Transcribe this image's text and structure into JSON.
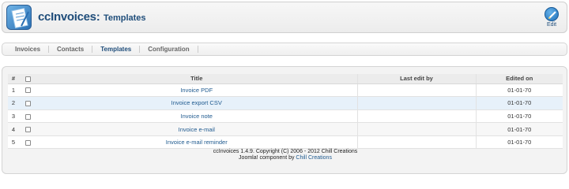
{
  "header": {
    "logo_icon": "invoice-logo-icon",
    "app_name": "ccInvoices:",
    "page_name": "Templates",
    "edit_label": "Edit",
    "edit_icon": "pencil-icon"
  },
  "tabs": [
    {
      "label": "Invoices",
      "active": false
    },
    {
      "label": "Contacts",
      "active": false
    },
    {
      "label": "Templates",
      "active": true
    },
    {
      "label": "Configuration",
      "active": false
    }
  ],
  "table": {
    "headers": {
      "num": "#",
      "title": "Title",
      "last_edit_by": "Last edit by",
      "edited_on": "Edited on"
    },
    "rows": [
      {
        "num": "1",
        "title": "Invoice PDF",
        "last_edit_by": "",
        "edited_on": "01-01-70"
      },
      {
        "num": "2",
        "title": "Invoice export CSV",
        "last_edit_by": "",
        "edited_on": "01-01-70"
      },
      {
        "num": "3",
        "title": "Invoice note",
        "last_edit_by": "",
        "edited_on": "01-01-70"
      },
      {
        "num": "4",
        "title": "Invoice e-mail",
        "last_edit_by": "",
        "edited_on": "01-01-70"
      },
      {
        "num": "5",
        "title": "Invoice e-mail reminder",
        "last_edit_by": "",
        "edited_on": "01-01-70"
      }
    ]
  },
  "footer": {
    "line1": "ccInvoices 1.4.9. Copyright (C) 2006 - 2012 Chill Creations",
    "line2_prefix": "Joomla! component by ",
    "line2_link": "Chill Creations"
  },
  "colors": {
    "accent": "#1f4d7a",
    "link": "#1f5a8f",
    "highlight_row": "#e7f1fa"
  }
}
